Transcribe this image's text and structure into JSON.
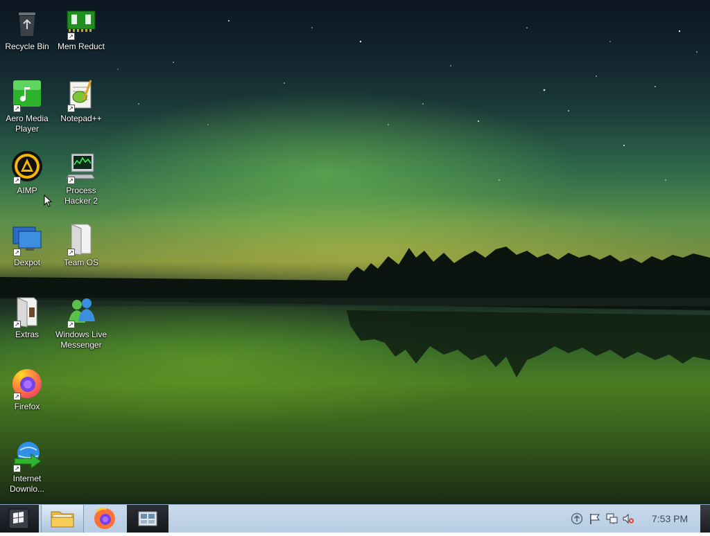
{
  "desktop": {
    "icons": [
      {
        "label": "Recycle Bin",
        "icon": "recycle-bin-icon"
      },
      {
        "label": "Mem Reduct",
        "icon": "memory-chip-icon"
      },
      {
        "label": "Aero Media Player",
        "icon": "music-note-icon"
      },
      {
        "label": "Notepad++",
        "icon": "notepad-icon"
      },
      {
        "label": "AIMP",
        "icon": "aimp-icon"
      },
      {
        "label": "Process Hacker 2",
        "icon": "computer-monitor-icon"
      },
      {
        "label": "Dexpot",
        "icon": "desktop-screens-icon"
      },
      {
        "label": "Team OS",
        "icon": "folder-icon"
      },
      {
        "label": "Extras",
        "icon": "folder-icon"
      },
      {
        "label": "Windows Live Messenger",
        "icon": "messenger-buddies-icon"
      },
      {
        "label": "Firefox",
        "icon": "firefox-icon"
      },
      {
        "label": "Internet Downlo...",
        "icon": "globe-download-icon"
      }
    ]
  },
  "taskbar": {
    "start_icon": "windows-logo-icon",
    "pinned": [
      {
        "name": "File Explorer",
        "icon": "folder-icon"
      },
      {
        "name": "Firefox",
        "icon": "firefox-icon"
      },
      {
        "name": "Task View",
        "icon": "window-switcher-icon"
      }
    ],
    "tray_icons": [
      "up-arrow-icon",
      "flag-icon",
      "network-icon",
      "volume-muted-icon"
    ],
    "clock": "7:53 PM"
  }
}
